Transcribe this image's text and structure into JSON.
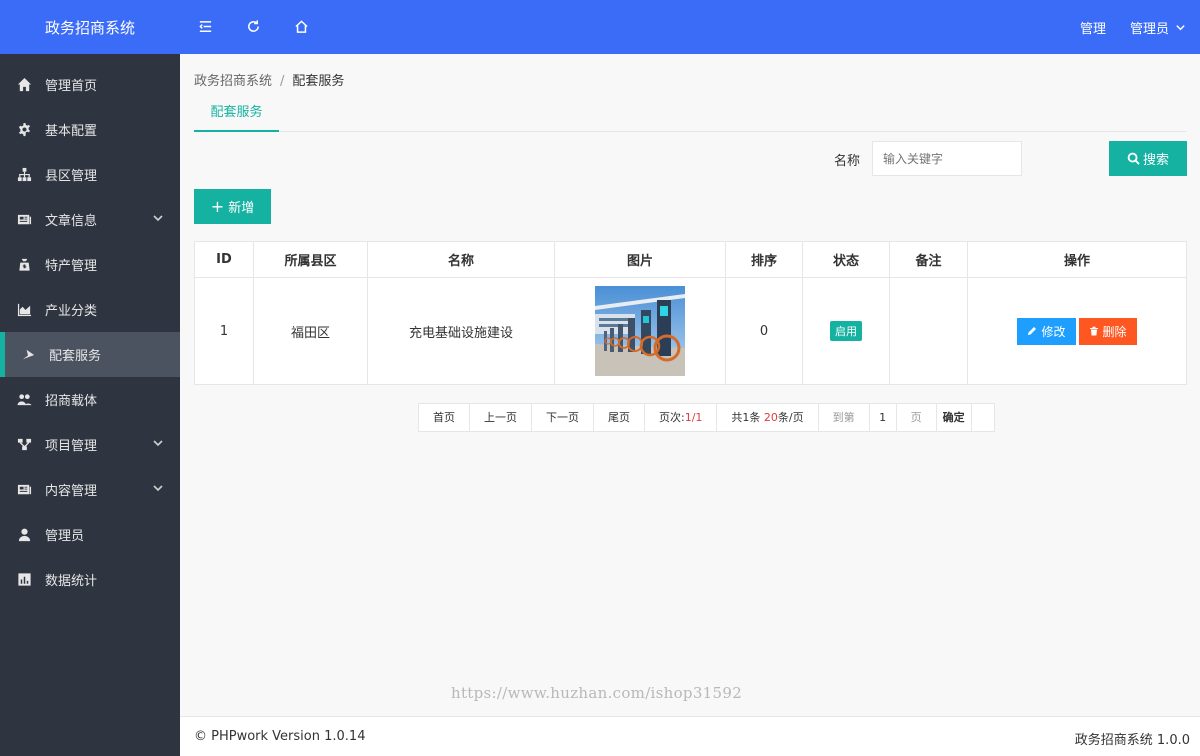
{
  "app": {
    "title": "政务招商系统"
  },
  "sidebar": {
    "items": [
      {
        "label": "管理首页"
      },
      {
        "label": "基本配置"
      },
      {
        "label": "县区管理"
      },
      {
        "label": "文章信息"
      },
      {
        "label": "特产管理"
      },
      {
        "label": "产业分类"
      },
      {
        "label": "配套服务"
      },
      {
        "label": "招商载体"
      },
      {
        "label": "项目管理"
      },
      {
        "label": "内容管理"
      },
      {
        "label": "管理员"
      },
      {
        "label": "数据统计"
      }
    ]
  },
  "topbar": {
    "manage_label": "管理",
    "user_label": "管理员"
  },
  "breadcrumb": {
    "root": "政务招商系统",
    "separator": "/",
    "current": "配套服务"
  },
  "tabs": [
    {
      "label": "配套服务"
    }
  ],
  "search": {
    "label": "名称",
    "placeholder": "输入关键字",
    "button_label": "搜索"
  },
  "toolbar": {
    "add_label": "新增"
  },
  "table": {
    "headers": [
      "ID",
      "所属县区",
      "名称",
      "图片",
      "排序",
      "状态",
      "备注",
      "操作"
    ],
    "rows": [
      {
        "id": "1",
        "county": "福田区",
        "name": "充电基础设施建设",
        "sort": "0",
        "status": "启用",
        "remark": "",
        "edit_label": "修改",
        "delete_label": "删除"
      }
    ]
  },
  "pagination": {
    "first": "首页",
    "prev": "上一页",
    "next": "下一页",
    "last": "尾页",
    "page_prefix": "页次:",
    "page_value": "1/1",
    "total_prefix": "共1条 ",
    "per_page_value": "20",
    "per_page_suffix": "条/页",
    "goto_label": "到第",
    "goto_value": "1",
    "page_unit": "页",
    "confirm_label": "确定"
  },
  "watermark": "https://www.huzhan.com/ishop31592",
  "footer": {
    "left": "© PHPwork Version 1.0.14",
    "right": "政务招商系统 1.0.0"
  },
  "colors": {
    "primary_blue": "#3b6cf8",
    "sidebar_bg": "#2f3540",
    "accent_teal": "#16b2a1",
    "edit_blue": "#1e9fff",
    "delete_orange": "#ff5722"
  },
  "icons": {
    "sidebar": [
      "home-icon",
      "gear-icon",
      "sitemap-icon",
      "newspaper-icon",
      "bag-icon",
      "area-chart-icon",
      "send-icon",
      "users-icon",
      "connection-icon",
      "content-icon",
      "user-icon",
      "bar-chart-icon"
    ],
    "topbar": [
      "menu-toggle-icon",
      "refresh-icon",
      "home-outline-icon"
    ]
  }
}
